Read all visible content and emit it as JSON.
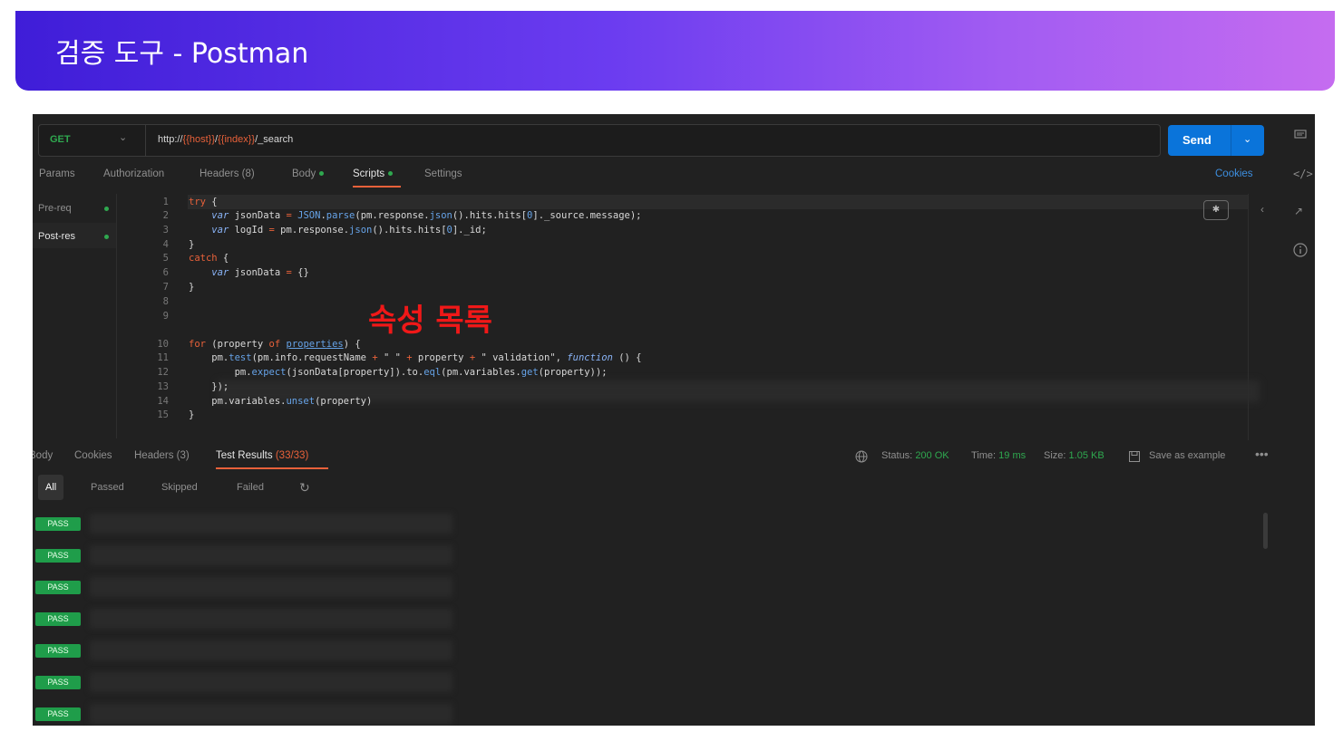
{
  "slide": {
    "title": "검증 도구 - Postman"
  },
  "request": {
    "method": "GET",
    "url_prefix": "http://",
    "url_var1": "{{host}}",
    "url_slash": "/",
    "url_var2": "{{index}}",
    "url_suffix": "/_search",
    "send_label": "Send"
  },
  "request_tabs": {
    "params": "Params",
    "authorization": "Authorization",
    "headers": "Headers (8)",
    "body": "Body",
    "scripts": "Scripts",
    "settings": "Settings",
    "cookies": "Cookies"
  },
  "scripts_nav": {
    "pre_req": "Pre-req",
    "post_res": "Post-res"
  },
  "code": {
    "numbers": [
      "1",
      "2",
      "3",
      "4",
      "5",
      "6",
      "7",
      "8",
      "9",
      "10",
      "11",
      "12",
      "13",
      "14",
      "15"
    ]
  },
  "overlay_text": "속성 목록",
  "response_tabs": {
    "body": "Body",
    "cookies": "Cookies",
    "headers": "Headers (3)",
    "test_results": "Test Results",
    "test_count": "(33/33)"
  },
  "response_status": {
    "status_label": "Status:",
    "status_value": "200 OK",
    "time_label": "Time:",
    "time_value": "19 ms",
    "size_label": "Size:",
    "size_value": "1.05 KB",
    "save_example": "Save as example"
  },
  "filters": {
    "all": "All",
    "passed": "Passed",
    "skipped": "Skipped",
    "failed": "Failed"
  },
  "test_results": [
    {
      "badge": "PASS"
    },
    {
      "badge": "PASS"
    },
    {
      "badge": "PASS"
    },
    {
      "badge": "PASS"
    },
    {
      "badge": "PASS"
    },
    {
      "badge": "PASS"
    },
    {
      "badge": "PASS"
    }
  ],
  "icons": {
    "method_dropdown": "chevron-down-icon",
    "send_dropdown": "chevron-down-icon",
    "comments": "comment-icon",
    "code": "code-icon",
    "info": "info-icon",
    "refresh": "refresh-icon",
    "globe": "globe-icon",
    "save": "save-icon",
    "more": "more-icon"
  },
  "colors": {
    "banner_start": "#3f1dd8",
    "banner_end": "#c56cf0",
    "send_button": "#0a74da",
    "pass_badge": "#1f9d4a",
    "accent": "#e8613a"
  }
}
